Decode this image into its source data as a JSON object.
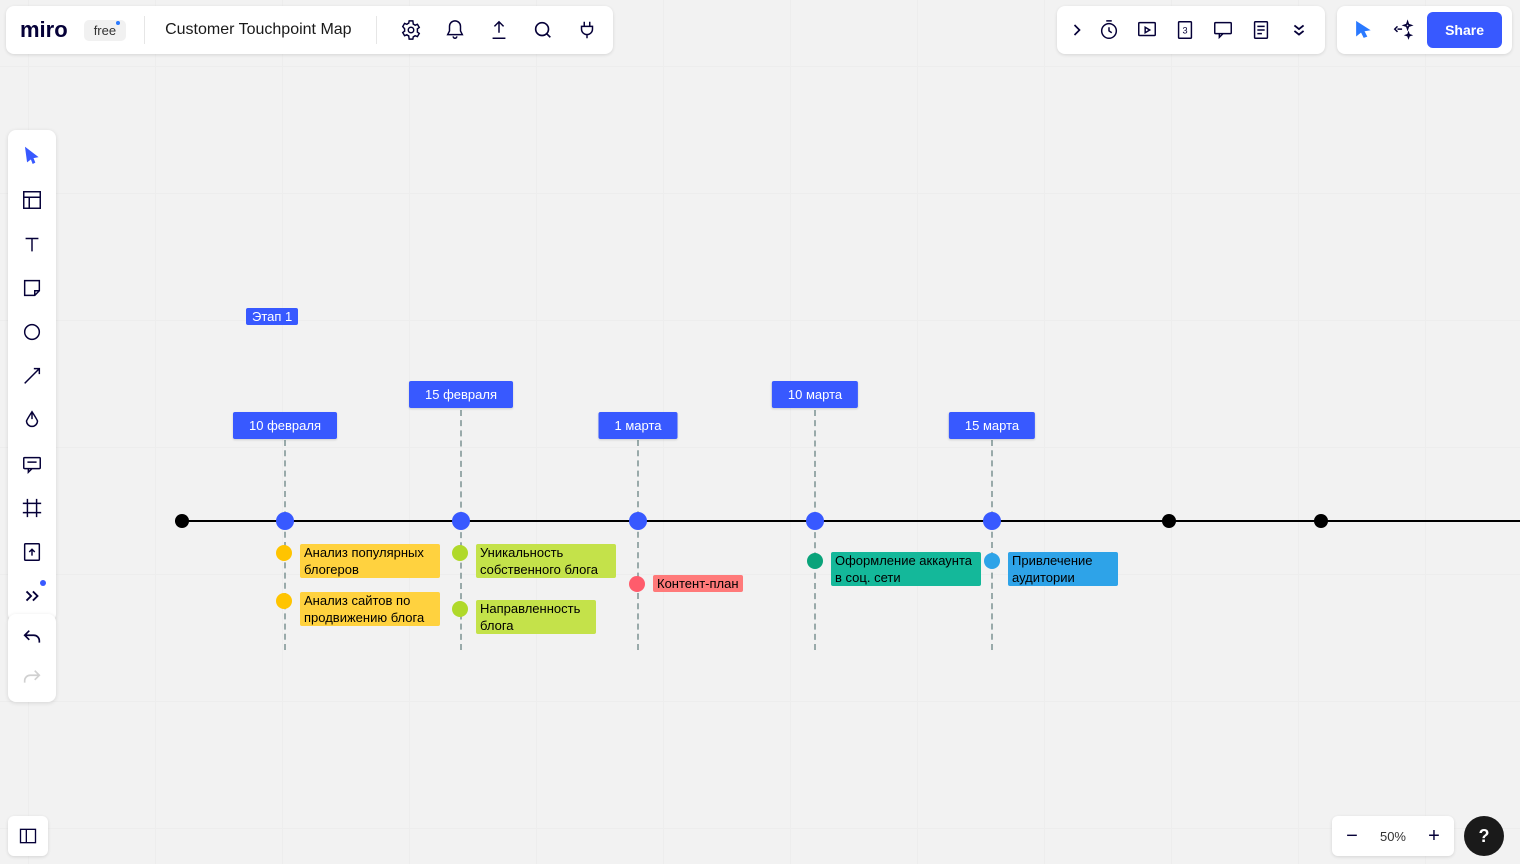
{
  "header": {
    "logo": "miro",
    "plan": "free",
    "board_title": "Customer Touchpoint Map",
    "share": "Share"
  },
  "zoom": {
    "level": "50%"
  },
  "help": "?",
  "diagram": {
    "stage_label": "Этап 1",
    "dates": {
      "d1": "10 февраля",
      "d2": "15 февраля",
      "d3": "1 марта",
      "d4": "10 марта",
      "d5": "15 марта"
    },
    "tasks": {
      "t1a": "Анализ популярных блогеров",
      "t1b": "Анализ сайтов по продвижению блога",
      "t2a": "Уникальность собственного блога",
      "t2b": "Направленность блога",
      "t3": "Контент-план",
      "t4": "Оформление аккаунта в соц. сети",
      "t5": "Привлечение аудитории"
    }
  }
}
